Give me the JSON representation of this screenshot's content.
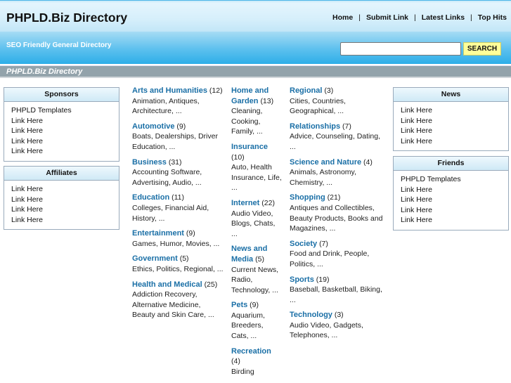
{
  "header": {
    "title": "PHPLD.Biz Directory",
    "nav": [
      "Home",
      "Submit Link",
      "Latest Links",
      "Top Hits"
    ],
    "slogan": "SEO Friendly General Directory",
    "search_value": "",
    "search_button": "SEARCH"
  },
  "breadcrumb": "PHPLD.Biz Directory",
  "sponsors": {
    "title": "Sponsors",
    "items": [
      "PHPLD Templates",
      "Link Here",
      "Link Here",
      "Link Here",
      "Link Here"
    ]
  },
  "affiliates": {
    "title": "Affiliates",
    "items": [
      "Link Here",
      "Link Here",
      "Link Here",
      "Link Here"
    ]
  },
  "news": {
    "title": "News",
    "items": [
      "Link Here",
      "Link Here",
      "Link Here",
      "Link Here"
    ]
  },
  "friends": {
    "title": "Friends",
    "items": [
      "PHPLD Templates",
      "Link Here",
      "Link Here",
      "Link Here",
      "Link Here"
    ]
  },
  "columns": [
    [
      {
        "name": "Arts and Humanities",
        "count": "(12)",
        "sub": "Animation, Antiques, Architecture, ..."
      },
      {
        "name": "Automotive",
        "count": "(9)",
        "sub": "Boats, Dealerships, Driver Education, ..."
      },
      {
        "name": "Business",
        "count": "(31)",
        "sub": "Accounting Software, Advertising, Audio, ..."
      },
      {
        "name": "Education",
        "count": "(11)",
        "sub": "Colleges, Financial Aid, History, ..."
      },
      {
        "name": "Entertainment",
        "count": "(9)",
        "sub": "Games, Humor, Movies, ..."
      },
      {
        "name": "Government",
        "count": "(5)",
        "sub": "Ethics, Politics, Regional, ..."
      },
      {
        "name": "Health and Medical",
        "count": "(25)",
        "sub": "Addiction Recovery, Alternative Medicine, Beauty and Skin Care, ..."
      }
    ],
    [
      {
        "name": "Home and Garden",
        "count": "(13)",
        "sub": "Cleaning, Cooking, Family, ..."
      },
      {
        "name": "Insurance",
        "count": "(10)",
        "sub": "Auto, Health Insurance, Life, ..."
      },
      {
        "name": "Internet",
        "count": "(22)",
        "sub": "Audio Video, Blogs, Chats, ..."
      },
      {
        "name": "News and Media",
        "count": "(5)",
        "sub": "Current News, Radio, Technology, ..."
      },
      {
        "name": "Pets",
        "count": "(9)",
        "sub": "Aquarium, Breeders, Cats, ..."
      },
      {
        "name": "Recreation",
        "count": "(4)",
        "sub": "Birding"
      }
    ],
    [
      {
        "name": "Regional",
        "count": "(3)",
        "sub": "Cities, Countries, Geographical, ..."
      },
      {
        "name": "Relationships",
        "count": "(7)",
        "sub": "Advice, Counseling, Dating, ..."
      },
      {
        "name": "Science and Nature",
        "count": "(4)",
        "sub": "Animals, Astronomy, Chemistry, ..."
      },
      {
        "name": "Shopping",
        "count": "(21)",
        "sub": "Antiques and Collectibles, Beauty Products, Books and Magazines, ..."
      },
      {
        "name": "Society",
        "count": "(7)",
        "sub": "Food and Drink, People, Politics, ..."
      },
      {
        "name": "Sports",
        "count": "(19)",
        "sub": "Baseball, Basketball, Biking, ..."
      },
      {
        "name": "Technology",
        "count": "(3)",
        "sub": "Audio Video, Gadgets, Telephones, ..."
      }
    ]
  ]
}
